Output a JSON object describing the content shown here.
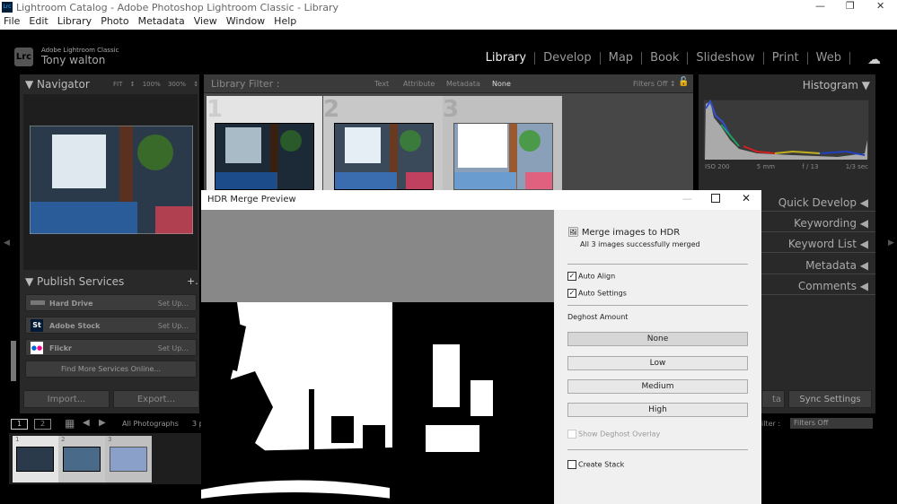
{
  "window": {
    "title": "Lightroom Catalog - Adobe Photoshop Lightroom Classic - Library",
    "app_icon": "Lrc"
  },
  "menu": [
    "File",
    "Edit",
    "Library",
    "Photo",
    "Metadata",
    "View",
    "Window",
    "Help"
  ],
  "identity": {
    "product": "Adobe Lightroom Classic",
    "user": "Tony walton",
    "logo": "Lrc"
  },
  "modules": [
    "Library",
    "Develop",
    "Map",
    "Book",
    "Slideshow",
    "Print",
    "Web"
  ],
  "active_module": "Library",
  "navigator": {
    "title": "Navigator",
    "zoom": [
      "FIT ↕",
      "100%",
      "300% ↕"
    ]
  },
  "publish": {
    "title": "Publish Services",
    "add": "+.",
    "services": [
      {
        "name": "Hard Drive",
        "action": "Set Up..."
      },
      {
        "name": "Adobe Stock",
        "action": "Set Up...",
        "icon": "St"
      },
      {
        "name": "Flickr",
        "action": "Set Up..."
      }
    ],
    "find_more": "Find More Services Online..."
  },
  "left_buttons": {
    "import": "Import...",
    "export": "Export..."
  },
  "filter": {
    "label": "Library Filter :",
    "options": [
      "Text",
      "Attribute",
      "Metadata",
      "None"
    ],
    "active": "None",
    "preset": "Filters Off ↕"
  },
  "grid": {
    "numbers": [
      "1",
      "2",
      "3"
    ]
  },
  "histogram": {
    "title": "Histogram",
    "info": [
      "ISO 200",
      "5 mm",
      "f / 13",
      "1/3 sec"
    ]
  },
  "right_panels": [
    "Quick Develop",
    "Keywording",
    "Keyword List",
    "Metadata",
    "Comments"
  ],
  "right_buttons": {
    "sync_metadata": "ta",
    "sync_settings": "Sync Settings"
  },
  "filmstrip": {
    "pages": [
      "1",
      "2"
    ],
    "source": "All Photographs",
    "count": "3 p",
    "filter_label": "ilter :",
    "filter_value": "Filters Off",
    "numbers": [
      "1",
      "2",
      "3"
    ]
  },
  "dialog": {
    "title": "HDR Merge Preview",
    "heading": "Merge images to HDR",
    "status": "All 3 images successfully merged",
    "auto_align": {
      "label": "Auto Align",
      "checked": true
    },
    "auto_settings": {
      "label": "Auto Settings",
      "checked": true
    },
    "deghost_label": "Deghost Amount",
    "deghost_options": [
      "None",
      "Low",
      "Medium",
      "High"
    ],
    "deghost_selected": "None",
    "show_overlay": {
      "label": "Show Deghost Overlay",
      "checked": false,
      "disabled": true
    },
    "create_stack": {
      "label": "Create Stack",
      "checked": false
    }
  }
}
